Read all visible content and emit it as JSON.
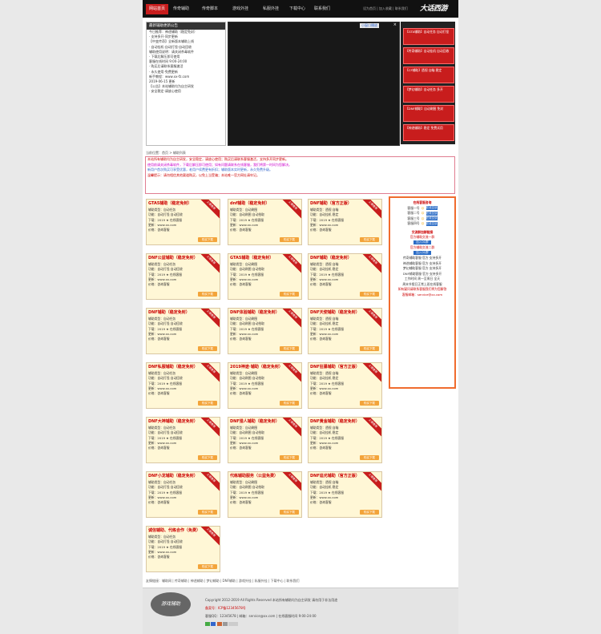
{
  "nav": {
    "items": [
      "网站首页",
      "传奇辅助",
      "传奇脚本",
      "游戏外挂",
      "私服外挂",
      "下载中心",
      "联系我们"
    ],
    "top_links": "设为首页 | 加入收藏 | 联系我们",
    "logo_text": "大话西游"
  },
  "news": {
    "header": "最新辅助更新公告",
    "lines": [
      "今日推荐：神途辅助（稳定免封）",
      "· 支持多开·同步更新",
      "【中变传奇】全新版本辅助上线",
      "· 自动挂机·自动打怪·自动回收",
      "辅助使用说明：请关闭杀毒软件",
      "· 下载后解压即可使用",
      "客服在线时间 9:00-24:00",
      "· 购买后请联系客服激活",
      "· 永久使用·免费更新",
      "新手教程：www.xx-fz.com",
      "2019-06-15 更新",
      "",
      "【公告】本站辅助均为自主研发",
      "· 安全稳定·请放心使用"
    ]
  },
  "video": {
    "tag": "小窗口播放",
    "close": "×"
  },
  "side_buttons": [
    "【GTA辅助】自动任务 自动打怪",
    "【传奇辅助】自动挂机 自动回收",
    "【CF辅助】透视 自瞄 稳定",
    "【梦幻辅助】自动任务 多开",
    "【DNF辅助】自动刷图 免封",
    "【神途辅助】稳定 免费试用"
  ],
  "breadcrumb": "当前位置：首页 > 辅助列表",
  "notice": {
    "lines": [
      "本站所有辅助均为自主研发，安全稳定，请放心使用；购买后请联系客服激活，支持多开同步更新。",
      "使用前请关闭杀毒软件，下载后解压即可使用；如有问题请联系在线客服，我们将第一时间为您解决。",
      "新用户首次购买可享受优惠，老用户续费更有折扣；辅助版本实时更新，永久免费升级。",
      "温馨提示：请勿相信其他渠道购买，以免上当受骗；本站唯一官方网址请牢记。"
    ]
  },
  "cards": [
    {
      "title": "GTA5辅助（稳定免封）",
      "lines": [
        "辅助类型：自动任务",
        "功能：自动打怪 自动回收",
        "下载：2019 ★ 在线客服",
        "更新：www.xx.com",
        "价格：咨询客服"
      ],
      "ribbon": "火爆推荐",
      "btn": "购买下载"
    },
    {
      "title": "dnf辅助（稳定免封）",
      "lines": [
        "辅助类型：自动刷图",
        "功能：自动刷图 自动拾取",
        "下载：2019 ★ 在线客服",
        "更新：www.xx.com",
        "价格：咨询客服"
      ],
      "ribbon": "火爆推荐",
      "btn": "购买下载"
    },
    {
      "title": "DNF辅助（官方正版）",
      "lines": [
        "辅助类型：透视 自瞄",
        "功能：自动挂机 稳定",
        "下载：2019 ★ 在线客服",
        "更新：www.xx.com",
        "价格：咨询客服"
      ],
      "ribbon": "火爆推荐",
      "btn": "购买下载"
    },
    {
      "title": "DNF公益辅助（稳定免封）",
      "lines": [
        "辅助类型：自动任务",
        "功能：自动打怪 自动回收",
        "下载：2019 ★ 在线客服",
        "更新：www.xx.com",
        "价格：咨询客服"
      ],
      "ribbon": "火爆推荐",
      "btn": "购买下载"
    },
    {
      "title": "GTA5辅助（稳定免封）",
      "lines": [
        "辅助类型：自动刷图",
        "功能：自动刷图 自动拾取",
        "下载：2019 ★ 在线客服",
        "更新：www.xx.com",
        "价格：咨询客服"
      ],
      "ribbon": "火爆推荐",
      "btn": "购买下载"
    },
    {
      "title": "DNF辅助（稳定免封）",
      "lines": [
        "辅助类型：透视 自瞄",
        "功能：自动挂机 稳定",
        "下载：2019 ★ 在线客服",
        "更新：www.xx.com",
        "价格：咨询客服"
      ],
      "ribbon": "火爆推荐",
      "btn": "购买下载"
    },
    {
      "title": "DNF辅助（稳定免封）",
      "lines": [
        "辅助类型：自动任务",
        "功能：自动打怪 自动回收",
        "下载：2019 ★ 在线客服",
        "更新：www.xx.com",
        "价格：咨询客服"
      ],
      "ribbon": "火爆推荐",
      "btn": "购买下载"
    },
    {
      "title": "DNF体验辅助（稳定免封）",
      "lines": [
        "辅助类型：自动刷图",
        "功能：自动刷图 自动拾取",
        "下载：2019 ★ 在线客服",
        "更新：www.xx.com",
        "价格：咨询客服"
      ],
      "ribbon": "火爆推荐",
      "btn": "购买下载"
    },
    {
      "title": "DNF天使辅助（稳定免封）",
      "lines": [
        "辅助类型：透视 自瞄",
        "功能：自动挂机 稳定",
        "下载：2019 ★ 在线客服",
        "更新：www.xx.com",
        "价格：咨询客服"
      ],
      "ribbon": "火爆推荐",
      "btn": "购买下载"
    },
    {
      "title": "DNF私服辅助（稳定免封）",
      "lines": [
        "辅助类型：自动任务",
        "功能：自动打怪 自动回收",
        "下载：2019 ★ 在线客服",
        "更新：www.xx.com",
        "价格：咨询客服"
      ],
      "ribbon": "火爆推荐",
      "btn": "购买下载"
    },
    {
      "title": "2019神途·辅助（稳定免封）",
      "lines": [
        "辅助类型：自动刷图",
        "功能：自动刷图 自动拾取",
        "下载：2019 ★ 在线客服",
        "更新：www.xx.com",
        "价格：咨询客服"
      ],
      "ribbon": "火爆推荐",
      "btn": "购买下载"
    },
    {
      "title": "DNF狂暴辅助（官方正版）",
      "lines": [
        "辅助类型：透视 自瞄",
        "功能：自动挂机 稳定",
        "下载：2019 ★ 在线客服",
        "更新：www.xx.com",
        "价格：咨询客服"
      ],
      "ribbon": "火爆推荐",
      "btn": "购买下载"
    },
    {
      "title": "DNF大神辅助（稳定免封）",
      "lines": [
        "辅助类型：自动任务",
        "功能：自动打怪 自动回收",
        "下载：2019 ★ 在线客服",
        "更新：www.xx.com",
        "价格：咨询客服"
      ],
      "ribbon": "火爆推荐",
      "btn": "购买下载"
    },
    {
      "title": "DNF猎人辅助（稳定免封）",
      "lines": [
        "辅助类型：自动刷图",
        "功能：自动刷图 自动拾取",
        "下载：2019 ★ 在线客服",
        "更新：www.xx.com",
        "价格：咨询客服"
      ],
      "ribbon": "火爆推荐",
      "btn": "购买下载"
    },
    {
      "title": "DNF黄金辅助（稳定免封）",
      "lines": [
        "辅助类型：透视 自瞄",
        "功能：自动挂机 稳定",
        "下载：2019 ★ 在线客服",
        "更新：www.xx.com",
        "价格：咨询客服"
      ],
      "ribbon": "火爆推荐",
      "btn": "购买下载"
    },
    {
      "title": "DNF小龙辅助（稳定免封）",
      "lines": [
        "辅助类型：自动任务",
        "功能：自动打怪 自动回收",
        "下载：2019 ★ 在线客服",
        "更新：www.xx.com",
        "价格：咨询客服"
      ],
      "ribbon": "火爆推荐",
      "btn": "购买下载"
    },
    {
      "title": "代练辅助服务（公益免费）",
      "lines": [
        "辅助类型：自动刷图",
        "功能：自动刷图 自动拾取",
        "下载：2019 ★ 在线客服",
        "更新：www.xx.com",
        "价格：咨询客服"
      ],
      "ribbon": "火爆推荐",
      "btn": "购买下载"
    },
    {
      "title": "DNF追光辅助（官方正版）",
      "lines": [
        "辅助类型：透视 自瞄",
        "功能：自动挂机 稳定",
        "下载：2019 ★ 在线客服",
        "更新：www.xx.com",
        "价格：咨询客服"
      ],
      "ribbon": "火爆推荐",
      "btn": "购买下载"
    },
    {
      "title": "诚信辅助、代练合作（免费）",
      "lines": [
        "辅助类型：自动任务",
        "功能：自动打怪 自动回收",
        "下载：2019 ★ 在线客服",
        "更新：www.xx.com",
        "价格：咨询客服"
      ],
      "ribbon": "火爆推荐",
      "btn": "购买下载"
    }
  ],
  "side": {
    "title": "在线客服咨询",
    "qq_rows": [
      "客服一号",
      "客服二号",
      "客服三号",
      "客服四号"
    ],
    "qq_btn": "在线交谈",
    "group_title": "交流群加群链接",
    "group_btn": "加入QQ群",
    "group_lines": [
      "官方辅助交流一群",
      "官方辅助交流二群"
    ],
    "info_lines": [
      "传奇辅助客服·官方·支持多开",
      "神途辅助客服·官方·支持多开",
      "梦幻辅助客服·官方·支持多开",
      "DNF辅助客服·官方·支持多开",
      "工作时间 周一至周日 全天",
      "周末节假日正常上班在线客服",
      "如有疑问请联系客服我们将为您解答",
      "客服邮箱：service@xx.com"
    ]
  },
  "footlinks": "友情链接：辅助网 | 传奇辅助 | 神途辅助 | 梦幻辅助 | DNF辅助 | 游戏外挂 | 私服外挂 | 下载中心 | 联系我们",
  "footer": {
    "logo": "游戏辅助",
    "copyright": "Copyright 2012-2019 All Rights Reserved 本站所有辅助均为自主研发 请勿用于非法用途",
    "icp": "备案号：ICP备12345678号",
    "contact": "客服QQ：12345678 | 邮箱：service@xx.com | 在线客服时间 9:00-24:00"
  }
}
